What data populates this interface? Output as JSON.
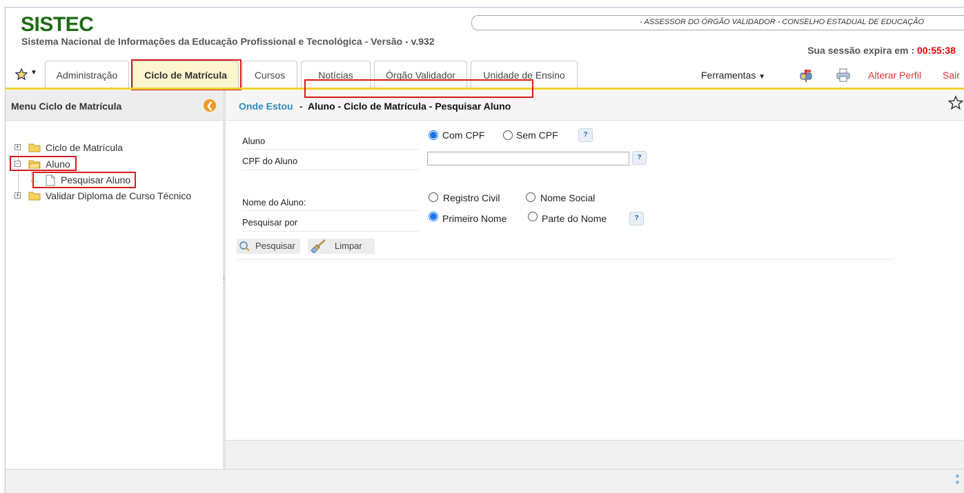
{
  "header": {
    "brand": "SISTEC",
    "subtitle": "Sistema Nacional de Informações da Educação Profissional e Tecnológica - Versão - v.932",
    "user_role": "- ASSESSOR DO ÓRGÃO VALIDADOR - CONSELHO ESTADUAL DE EDUCAÇÃO",
    "session_label": "Sua sessão expira em : ",
    "session_time": "00:55:38"
  },
  "tabs": [
    {
      "label": "Administração",
      "active": false
    },
    {
      "label": "Ciclo de Matrícula",
      "active": true
    },
    {
      "label": "Cursos",
      "active": false
    },
    {
      "label": "Notícias",
      "active": false
    },
    {
      "label": "Órgão Validador",
      "active": false
    },
    {
      "label": "Unidade de Ensino",
      "active": false
    }
  ],
  "toolbar": {
    "tools_label": "Ferramentas",
    "change_profile": "Alterar Perfil",
    "logout": "Sair"
  },
  "sidebar": {
    "title": "Menu Ciclo de Matrícula",
    "tree": [
      {
        "label": "Ciclo de Matrícula",
        "expanded": false
      },
      {
        "label": "Aluno",
        "expanded": true,
        "children": [
          {
            "label": "Pesquisar Aluno"
          }
        ]
      },
      {
        "label": "Validar Diploma de Curso Técnico",
        "expanded": false
      }
    ]
  },
  "breadcrumb": {
    "label": "Onde Estou",
    "separator": "-",
    "path": "Aluno - Ciclo de Matrícula - Pesquisar Aluno"
  },
  "form": {
    "aluno_label": "Aluno",
    "cpf_type_options": [
      {
        "label": "Com CPF",
        "selected": true
      },
      {
        "label": "Sem CPF",
        "selected": false
      }
    ],
    "cpf_label": "CPF do Aluno",
    "cpf_value": "",
    "nome_label": "Nome do Aluno:",
    "name_type_options": [
      {
        "label": "Registro Civil",
        "selected": false
      },
      {
        "label": "Nome Social",
        "selected": false
      }
    ],
    "search_by_label": "Pesquisar por",
    "search_by_options": [
      {
        "label": "Primeiro Nome",
        "selected": true
      },
      {
        "label": "Parte do Nome",
        "selected": false
      }
    ],
    "help_glyph": "?",
    "search_button": "Pesquisar",
    "clear_button": "Limpar"
  },
  "colors": {
    "brand_green": "#1e6b14",
    "accent_yellow": "#f0d12e",
    "link_blue": "#2b8ac0",
    "alert_red": "#e0302e",
    "highlight_red": "#d71a1a"
  }
}
